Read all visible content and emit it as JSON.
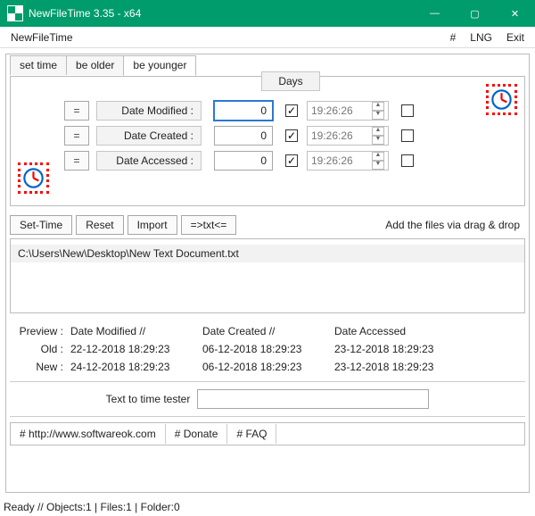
{
  "window": {
    "title": "NewFileTime 3.35 - x64"
  },
  "menubar": {
    "left": "NewFileTime",
    "right": [
      "#",
      "LNG",
      "Exit"
    ]
  },
  "tabs": [
    "set time",
    "be older",
    "be younger"
  ],
  "activeTab": 2,
  "daysHeader": "Days",
  "rows": [
    {
      "eq": "=",
      "label": "Date Modified :",
      "value": "0",
      "checked": true,
      "time": "19:26:26",
      "box2": false,
      "focus": true
    },
    {
      "eq": "=",
      "label": "Date Created :",
      "value": "0",
      "checked": true,
      "time": "19:26:26",
      "box2": false
    },
    {
      "eq": "=",
      "label": "Date Accessed :",
      "value": "0",
      "checked": true,
      "time": "19:26:26",
      "box2": false
    }
  ],
  "toolbar": {
    "setTime": "Set-Time",
    "reset": "Reset",
    "import": "Import",
    "txt": "=>txt<=",
    "dragDrop": "Add the files via drag & drop"
  },
  "fileList": {
    "items": [
      "C:\\Users\\New\\Desktop\\New Text Document.txt"
    ]
  },
  "preview": {
    "headerLabel": "Preview  :",
    "headers": [
      "Date Modified",
      "Date Created",
      "Date Accessed"
    ],
    "sep": "  //  ",
    "oldLabel": "Old :",
    "old": [
      "22-12-2018 18:29:23",
      "06-12-2018 18:29:23",
      "23-12-2018 18:29:23"
    ],
    "newLabel": "New :",
    "new": [
      "24-12-2018 18:29:23",
      "06-12-2018 18:29:23",
      "23-12-2018 18:29:23"
    ]
  },
  "tester": {
    "label": "Text to time tester",
    "value": ""
  },
  "links": [
    "# http://www.softwareok.com",
    "# Donate",
    "# FAQ"
  ],
  "status": "Ready // Objects:1 | Files:1 | Folder:0"
}
